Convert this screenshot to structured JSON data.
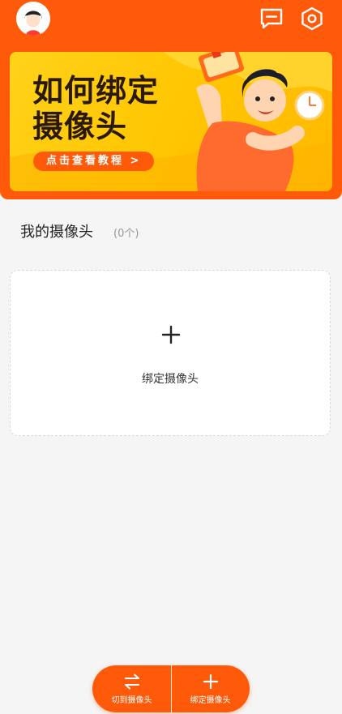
{
  "header": {
    "avatar_name": "avatar",
    "icons": [
      "message-icon",
      "settings-hex-icon"
    ]
  },
  "banner": {
    "title": "如何绑定摄像头",
    "cta": "点击查看教程 >"
  },
  "section": {
    "title": "我的摄像头",
    "count": "(0个)"
  },
  "bind_card": {
    "plus_icon": "plus-icon",
    "label": "绑定摄像头"
  },
  "bottom_bar": {
    "switch_label": "切到摄像头",
    "bind_label": "绑定摄像头"
  },
  "colors": {
    "accent": "#ff5a0a",
    "banner_yellow": "#ffc500",
    "text_dark": "#222222",
    "muted": "#999999"
  }
}
